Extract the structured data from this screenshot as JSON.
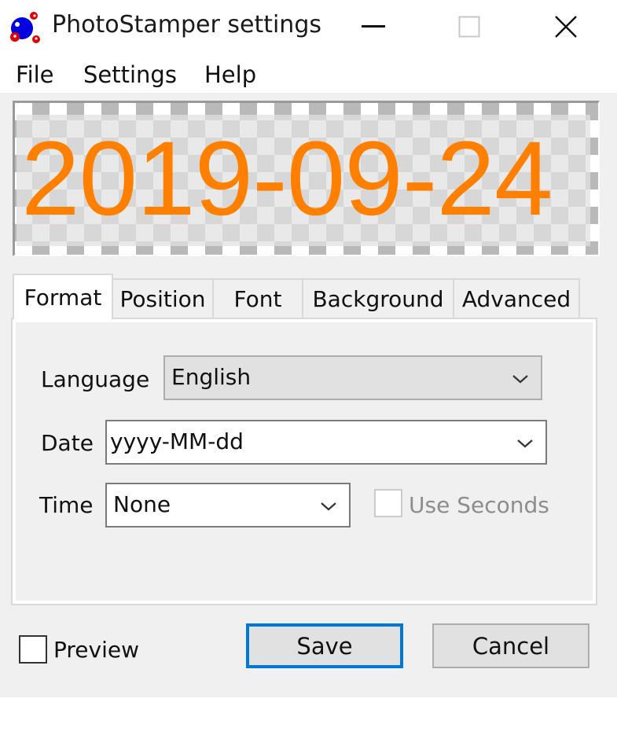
{
  "window": {
    "title": "PhotoStamper settings",
    "icon": "photostamper-molecule-icon",
    "controls": {
      "minimize": "minimize-icon",
      "maximize": "maximize-icon",
      "close": "close-icon"
    }
  },
  "menu": {
    "items": [
      {
        "label": "File"
      },
      {
        "label": "Settings"
      },
      {
        "label": "Help"
      }
    ]
  },
  "preview": {
    "stamp_text": "2019-09-24",
    "stamp_color": "#ff8000"
  },
  "tabs": [
    {
      "label": "Format",
      "active": true
    },
    {
      "label": "Position",
      "active": false
    },
    {
      "label": "Font",
      "active": false
    },
    {
      "label": "Background",
      "active": false
    },
    {
      "label": "Advanced",
      "active": false
    }
  ],
  "format": {
    "language": {
      "label": "Language",
      "value": "English"
    },
    "date": {
      "label": "Date",
      "value": "yyyy-MM-dd"
    },
    "time": {
      "label": "Time",
      "value": "None"
    },
    "use_seconds": {
      "label": "Use Seconds",
      "checked": false,
      "enabled": false
    }
  },
  "footer": {
    "preview_checkbox": {
      "label": "Preview",
      "checked": false
    },
    "save_label": "Save",
    "cancel_label": "Cancel"
  },
  "colors": {
    "accent": "#0078d7",
    "dialog_bg": "#f0f0f0"
  }
}
